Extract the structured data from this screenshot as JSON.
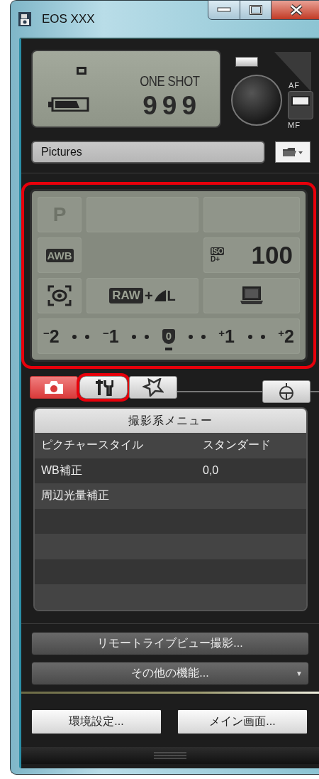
{
  "window": {
    "title": "EOS XXX"
  },
  "status_lcd": {
    "drive_mode": "ONE SHOT",
    "shots_remaining": "999"
  },
  "af_mf_switch": {
    "upper_label": "AF",
    "lower_label": "MF",
    "af_selected": true
  },
  "save_folder": {
    "value": "Pictures"
  },
  "settings_panel": {
    "highlighted": true,
    "shooting_mode": "P",
    "white_balance": "AWB",
    "iso_badge": "ISO",
    "iso_sub": "D+",
    "iso": "100",
    "quality_raw": "RAW",
    "quality_joiner": "+",
    "quality_size": "L",
    "exposure_scale": [
      {
        "text": "$^{−}$2",
        "current": false
      },
      {
        "text": "$^{−}$1",
        "current": false
      },
      {
        "text": "0",
        "current": true
      },
      {
        "text": "$^{+}$1",
        "current": false
      },
      {
        "text": "$^{+}$2",
        "current": false
      }
    ]
  },
  "tabs": [
    {
      "kind": "camera",
      "selected": true,
      "highlighted": false
    },
    {
      "kind": "tools",
      "selected": false,
      "highlighted": true
    },
    {
      "kind": "star",
      "selected": false,
      "highlighted": false
    }
  ],
  "menu": {
    "title": "撮影系メニュー",
    "rows": [
      {
        "label": "ピクチャースタイル",
        "value": "スタンダード"
      },
      {
        "label": "WB補正",
        "value": "0,0"
      },
      {
        "label": "周辺光量補正"
      }
    ]
  },
  "function_buttons": [
    {
      "label": "リモートライブビュー撮影...",
      "kind": "plain"
    },
    {
      "label": "その他の機能...",
      "kind": "dropdown",
      "caret": "▼"
    }
  ],
  "bottom_buttons": [
    "環境設定...",
    "メイン画面..."
  ]
}
